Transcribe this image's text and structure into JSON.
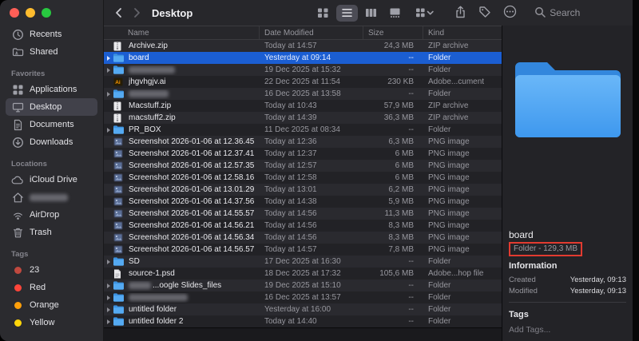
{
  "toolbar": {
    "title": "Desktop",
    "nav": [
      {
        "icon": "chevron-left-icon",
        "enabled": true
      },
      {
        "icon": "chevron-right-icon",
        "enabled": false
      }
    ],
    "view_buttons": [
      {
        "icon": "grid-view-icon",
        "selected": false
      },
      {
        "icon": "list-view-icon",
        "selected": true
      },
      {
        "icon": "column-view-icon",
        "selected": false
      },
      {
        "icon": "gallery-view-icon",
        "selected": false
      }
    ],
    "group_icon": "group-view-icon",
    "action_icons": [
      "share-icon",
      "tag-icon",
      "more-icon"
    ],
    "search_icon": "search-icon",
    "search_placeholder": "Search"
  },
  "sidebar": {
    "sections": [
      {
        "header": "",
        "items": [
          {
            "label": "Recents",
            "icon": "clock-icon"
          },
          {
            "label": "Shared",
            "icon": "shared-folder-icon"
          }
        ]
      },
      {
        "header": "Favorites",
        "items": [
          {
            "label": "Applications",
            "icon": "applications-icon"
          },
          {
            "label": "Desktop",
            "icon": "desktop-icon",
            "active": true
          },
          {
            "label": "Documents",
            "icon": "documents-icon"
          },
          {
            "label": "Downloads",
            "icon": "downloads-icon"
          }
        ]
      },
      {
        "header": "Locations",
        "items": [
          {
            "label": "iCloud Drive",
            "icon": "cloud-icon"
          },
          {
            "label": "",
            "icon": "home-icon",
            "blurred": true,
            "blur_width": 48
          },
          {
            "label": "AirDrop",
            "icon": "airdrop-icon"
          },
          {
            "label": "Trash",
            "icon": "trash-icon"
          }
        ]
      },
      {
        "header": "Tags",
        "items": [
          {
            "label": "23",
            "icon": "tag-dot",
            "color": "#c0493f"
          },
          {
            "label": "Red",
            "icon": "tag-dot",
            "color": "#ff453a"
          },
          {
            "label": "Orange",
            "icon": "tag-dot",
            "color": "#ff9f0a"
          },
          {
            "label": "Yellow",
            "icon": "tag-dot",
            "color": "#ffd60a"
          }
        ]
      }
    ]
  },
  "file_list": {
    "columns": [
      "Name",
      "Date Modified",
      "Size",
      "Kind"
    ],
    "rows": [
      {
        "name": "Archive.zip",
        "icon": "zip-icon",
        "date": "Today at 14:57",
        "size": "24,3 MB",
        "kind": "ZIP archive",
        "disclosure": false,
        "selected": false,
        "blurred": false
      },
      {
        "name": "board",
        "icon": "folder-icon",
        "date": "Yesterday at 09:14",
        "size": "--",
        "kind": "Folder",
        "disclosure": true,
        "selected": true,
        "blurred": false
      },
      {
        "name": "",
        "icon": "folder-icon",
        "date": "19 Dec 2025 at 15:32",
        "size": "--",
        "kind": "Folder",
        "disclosure": true,
        "selected": false,
        "blurred": "full",
        "blur_width": 58
      },
      {
        "name": "jhgvhgjv.ai",
        "icon": "ai-icon",
        "date": "22 Dec 2025 at 11:54",
        "size": "230 KB",
        "kind": "Adobe...cument",
        "disclosure": false,
        "selected": false,
        "blurred": false
      },
      {
        "name": "",
        "icon": "folder-icon",
        "date": "16 Dec 2025 at 13:58",
        "size": "--",
        "kind": "Folder",
        "disclosure": true,
        "selected": false,
        "blurred": "full",
        "blur_width": 50
      },
      {
        "name": "Macstuff.zip",
        "icon": "zip-icon",
        "date": "Today at 10:43",
        "size": "57,9 MB",
        "kind": "ZIP archive",
        "disclosure": false,
        "selected": false,
        "blurred": false
      },
      {
        "name": "macstuff2.zip",
        "icon": "zip-icon",
        "date": "Today at 14:39",
        "size": "36,3 MB",
        "kind": "ZIP archive",
        "disclosure": false,
        "selected": false,
        "blurred": false
      },
      {
        "name": "PR_BOX",
        "icon": "folder-icon",
        "date": "11 Dec 2025 at 08:34",
        "size": "--",
        "kind": "Folder",
        "disclosure": true,
        "selected": false,
        "blurred": false
      },
      {
        "name": "Screenshot 2026-01-06 at 12.36.45",
        "icon": "image-icon",
        "date": "Today at 12:36",
        "size": "6,3 MB",
        "kind": "PNG image",
        "disclosure": false,
        "selected": false,
        "blurred": false
      },
      {
        "name": "Screenshot 2026-01-06 at 12.37.41",
        "icon": "image-icon",
        "date": "Today at 12:37",
        "size": "6 MB",
        "kind": "PNG image",
        "disclosure": false,
        "selected": false,
        "blurred": false
      },
      {
        "name": "Screenshot 2026-01-06 at 12.57.35",
        "icon": "image-icon",
        "date": "Today at 12:57",
        "size": "6 MB",
        "kind": "PNG image",
        "disclosure": false,
        "selected": false,
        "blurred": false
      },
      {
        "name": "Screenshot 2026-01-06 at 12.58.16",
        "icon": "image-icon",
        "date": "Today at 12:58",
        "size": "6 MB",
        "kind": "PNG image",
        "disclosure": false,
        "selected": false,
        "blurred": false
      },
      {
        "name": "Screenshot 2026-01-06 at 13.01.29",
        "icon": "image-icon",
        "date": "Today at 13:01",
        "size": "6,2 MB",
        "kind": "PNG image",
        "disclosure": false,
        "selected": false,
        "blurred": false
      },
      {
        "name": "Screenshot 2026-01-06 at 14.37.56",
        "icon": "image-icon",
        "date": "Today at 14:38",
        "size": "5,9 MB",
        "kind": "PNG image",
        "disclosure": false,
        "selected": false,
        "blurred": false
      },
      {
        "name": "Screenshot 2026-01-06 at 14.55.57",
        "icon": "image-icon",
        "date": "Today at 14:56",
        "size": "11,3 MB",
        "kind": "PNG image",
        "disclosure": false,
        "selected": false,
        "blurred": false
      },
      {
        "name": "Screenshot 2026-01-06 at 14.56.21",
        "icon": "image-icon",
        "date": "Today at 14:56",
        "size": "8,3 MB",
        "kind": "PNG image",
        "disclosure": false,
        "selected": false,
        "blurred": false
      },
      {
        "name": "Screenshot 2026-01-06 at 14.56.34",
        "icon": "image-icon",
        "date": "Today at 14:56",
        "size": "8,3 MB",
        "kind": "PNG image",
        "disclosure": false,
        "selected": false,
        "blurred": false
      },
      {
        "name": "Screenshot 2026-01-06 at 14.56.57",
        "icon": "image-icon",
        "date": "Today at 14:57",
        "size": "7,8 MB",
        "kind": "PNG image",
        "disclosure": false,
        "selected": false,
        "blurred": false
      },
      {
        "name": "SD",
        "icon": "folder-icon",
        "date": "17 Dec 2025 at 16:30",
        "size": "--",
        "kind": "Folder",
        "disclosure": true,
        "selected": false,
        "blurred": false
      },
      {
        "name": "source-1.psd",
        "icon": "psd-icon",
        "date": "18 Dec 2025 at 17:32",
        "size": "105,6 MB",
        "kind": "Adobe...hop file",
        "disclosure": false,
        "selected": false,
        "blurred": false
      },
      {
        "name": "...oogle Slides_files",
        "icon": "folder-icon",
        "date": "19 Dec 2025 at 15:10",
        "size": "--",
        "kind": "Folder",
        "disclosure": true,
        "selected": false,
        "blurred": "prefix",
        "blur_width": 28
      },
      {
        "name": "",
        "icon": "folder-icon",
        "date": "16 Dec 2025 at 13:57",
        "size": "--",
        "kind": "Folder",
        "disclosure": true,
        "selected": false,
        "blurred": "full",
        "blur_width": 74
      },
      {
        "name": "untitled folder",
        "icon": "folder-icon",
        "date": "Yesterday at 16:00",
        "size": "--",
        "kind": "Folder",
        "disclosure": true,
        "selected": false,
        "blurred": false
      },
      {
        "name": "untitled folder 2",
        "icon": "folder-icon",
        "date": "Today at 14:40",
        "size": "--",
        "kind": "Folder",
        "disclosure": true,
        "selected": false,
        "blurred": false
      }
    ]
  },
  "preview": {
    "icon": "folder-icon-large",
    "file_name": "board",
    "file_meta": "Folder - 129,3 MB",
    "information_title": "Information",
    "info_rows": [
      {
        "label": "Created",
        "value": "Yesterday, 09:13"
      },
      {
        "label": "Modified",
        "value": "Yesterday, 09:13"
      }
    ],
    "tags_title": "Tags",
    "add_tags_placeholder": "Add Tags..."
  },
  "colors": {
    "selection_blue": "#1b5ed2",
    "folder_blue": "#4aa3ef",
    "annotation_red": "#e23b30",
    "traffic_lights": [
      "#ff5f57",
      "#febc2e",
      "#28c840"
    ]
  }
}
